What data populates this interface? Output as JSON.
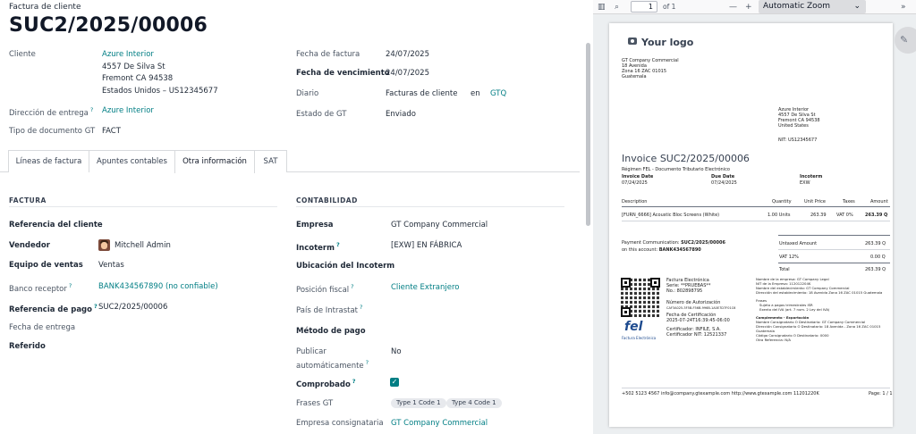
{
  "form": {
    "doc_type": "Factura de cliente",
    "doc_name": "SUC2/2025/00006",
    "left_fields": {
      "cliente_label": "Cliente",
      "cliente_name": "Azure Interior",
      "cliente_addr1": "4557 De Silva St",
      "cliente_addr2": "Fremont CA 94538",
      "cliente_addr3": "Estados Unidos – US12345677",
      "entrega_label": "Dirección de entrega",
      "entrega_value": "Azure Interior",
      "tipo_doc_label": "Tipo de documento GT",
      "tipo_doc_value": "FACT"
    },
    "right_fields": {
      "fecha_factura_label": "Fecha de factura",
      "fecha_factura_value": "24/07/2025",
      "fecha_venc_label": "Fecha de vencimiento",
      "fecha_venc_value": "24/07/2025",
      "diario_label": "Diario",
      "diario_value": "Facturas de cliente",
      "diario_en": "en",
      "diario_currency": "GTQ",
      "estado_label": "Estado de GT",
      "estado_value": "Enviado"
    },
    "tabs": [
      {
        "label": "Líneas de factura"
      },
      {
        "label": "Apuntes contables"
      },
      {
        "label": "Otra información"
      },
      {
        "label": "SAT"
      }
    ],
    "factura": {
      "title": "FACTURA",
      "ref_cliente_label": "Referencia del cliente",
      "vendedor_label": "Vendedor",
      "vendedor_value": "Mitchell Admin",
      "equipo_label": "Equipo de ventas",
      "equipo_value": "Ventas",
      "banco_label": "Banco receptor",
      "banco_value": "BANK434567890 (no confiable)",
      "ref_pago_label": "Referencia de pago",
      "ref_pago_value": "SUC2/2025/00006",
      "fecha_entrega_label": "Fecha de entrega",
      "referido_label": "Referido"
    },
    "contabilidad": {
      "title": "CONTABILIDAD",
      "empresa_label": "Empresa",
      "empresa_value": "GT Company Commercial",
      "incoterm_label": "Incoterm",
      "incoterm_value": "[EXW] EN FÁBRICA",
      "ubic_incoterm_label": "Ubicación del Incoterm",
      "posicion_label": "Posición fiscal",
      "posicion_value": "Cliente Extranjero",
      "pais_label": "País de Intrastat",
      "metodo_label": "Método de pago",
      "publicar_label_1": "Publicar",
      "publicar_label_2": "automáticamente",
      "publicar_value": "No",
      "comprobado_label": "Comprobado",
      "comprobado_checked": true,
      "frases_label": "Frases GT",
      "frases_tags": [
        "Type 1 Code 1",
        "Type 4 Code 1"
      ],
      "consignataria_label": "Empresa consignataria",
      "consignataria_value": "GT Company Commercial"
    }
  },
  "viewer": {
    "page_current": "1",
    "page_total": "of 1",
    "zoom_label": "Automatic Zoom",
    "zoom_minus": "—",
    "zoom_plus": "+",
    "pdf": {
      "logo": "Your logo",
      "company_lines": [
        "GT Company Commercial",
        "18 Avenida",
        "Zona 16 ZAC 01015",
        "Guatemala"
      ],
      "partner_lines": [
        "Azure Interior",
        "4557 De Silva St",
        "Fremont CA 94538",
        "United States"
      ],
      "partner_nit": "NIT: US12345677",
      "title": "Invoice SUC2/2025/00006",
      "regime": "Régimen FEL - Documento Tributario Electrónico",
      "invoice_date_label": "Invoice Date",
      "invoice_date": "07/24/2025",
      "due_date_label": "Due Date",
      "due_date": "07/24/2025",
      "incoterm_label": "Incoterm",
      "incoterm": "EXW",
      "cols": [
        "Description",
        "Quantity",
        "Unit Price",
        "Taxes",
        "Amount"
      ],
      "line": [
        "[FURN_6666] Acoustic Bloc Screens (White)",
        "1.00 Units",
        "263.39",
        "VAT 0%",
        "263.39 Q"
      ],
      "payment_comm_1": "Payment Communication:",
      "payment_comm_ref": "SUC2/2025/00006",
      "payment_comm_2": "on this account:",
      "payment_comm_acc": "BANK434567890",
      "untaxed_label": "Untaxed Amount",
      "untaxed": "263.39 Q",
      "vat_label": "VAT 12%",
      "vat": "0.00 Q",
      "total_label": "Total",
      "total": "263.39 Q",
      "fel_lines": [
        "Factura Electrónica",
        "Serie: **PRUEBAS**",
        "No.: 802898795"
      ],
      "auth_label": "Número de Autorización",
      "auth_value": "CAF3A025-3F5B-F56B-996B-1A0E7D7F01C6",
      "cert_label": "Fecha de Certificación",
      "cert_value": "2025-07-24T16:39:45-06:00",
      "certificador": "Certificador: INFILE, S.A.",
      "cert_nit": "Certificador NIT: 12521337",
      "issuer_lines": [
        "Nombre de la empresa: GT Company Legal",
        "NIT de la Empresa: 112012204K",
        "Nombre del establecimiento: GT Company Commercial",
        "Dirección del establecimiento: 18 Avenida Zona 16 ZAC 01015 Guatemala"
      ],
      "frases_title": "Frases",
      "frases_lines": [
        "Sujeto a pagos trimestrales ISR",
        "Exento del IVA (art. 7 num. 2 Ley del IVA)"
      ],
      "complemento_title": "Complemento - Exportación",
      "complemento_lines": [
        "Nombre Consignatario O Destinatario: GT Company Commercial",
        "Dirección Consignatario O Destinatario: 18 Avenida - Zona 16 ZAC 01015",
        "Guatemala",
        "Código Consignatario O Destinatario: 0000",
        "Otra Referencia: N/A"
      ],
      "fel_logo": "fel",
      "fel_logo_sub": "Factura Electrónica",
      "footer": "+502 5123 4567 info@company.gtexample.com http://www.gtexample.com 11201220K",
      "page_label": "Page: 1 / 1"
    }
  }
}
